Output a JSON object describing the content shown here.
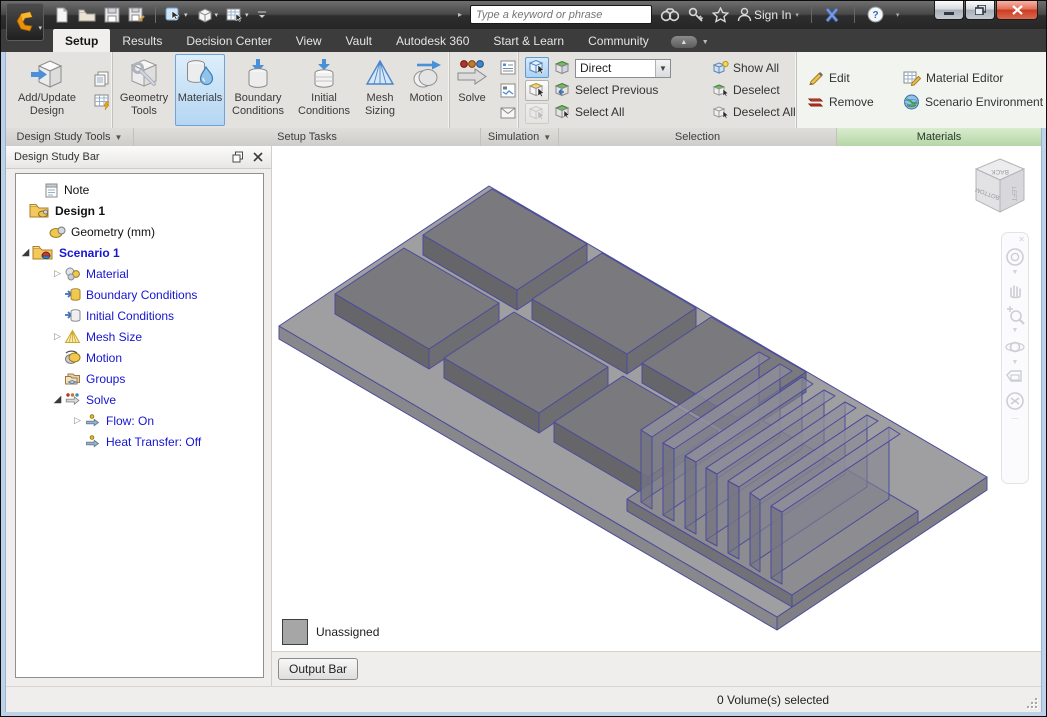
{
  "colors": {
    "selection_highlight": "#b5d6f2",
    "materials_panel_green": "#b5d6a6",
    "tree_item_blue": "#1515d2",
    "close_button_red": "#cc3b22",
    "model_fill_gray": "#8f8f93",
    "model_edge_purple": "#4b4b9b"
  },
  "titlebar": {
    "search_placeholder": "Type a keyword or phrase",
    "sign_in_label": "Sign In"
  },
  "tabs": {
    "items": [
      {
        "label": "Setup"
      },
      {
        "label": "Results"
      },
      {
        "label": "Decision Center"
      },
      {
        "label": "View"
      },
      {
        "label": "Vault"
      },
      {
        "label": "Autodesk 360"
      },
      {
        "label": "Start & Learn"
      },
      {
        "label": "Community"
      }
    ],
    "active_tab": "Setup"
  },
  "ribbon": {
    "design_study_tools": {
      "label": "Design Study Tools",
      "add_update_design": "Add/Update Design"
    },
    "setup_tasks": {
      "label": "Setup Tasks",
      "geometry_tools": "Geometry Tools",
      "materials": "Materials",
      "boundary_conditions": "Boundary Conditions",
      "initial_conditions": "Initial Conditions",
      "mesh_sizing": "Mesh Sizing",
      "motion": "Motion",
      "active_task": "Materials"
    },
    "simulation": {
      "label": "Simulation",
      "solve": "Solve"
    },
    "selection": {
      "label": "Selection",
      "mode_value": "Direct",
      "select_previous": "Select Previous",
      "select_all": "Select All",
      "show_all": "Show All",
      "deselect": "Deselect",
      "deselect_all": "Deselect All"
    },
    "materials_panel": {
      "label": "Materials",
      "edit": "Edit",
      "remove": "Remove",
      "material_editor": "Material Editor",
      "scenario_environment": "Scenario Environment"
    }
  },
  "design_study_bar": {
    "title": "Design Study Bar",
    "tree": [
      {
        "label": "Note"
      },
      {
        "label": "Design 1"
      },
      {
        "label": "Geometry (mm)"
      },
      {
        "label": "Scenario 1"
      },
      {
        "label": "Material"
      },
      {
        "label": "Boundary Conditions"
      },
      {
        "label": "Initial Conditions"
      },
      {
        "label": "Mesh Size"
      },
      {
        "label": "Motion"
      },
      {
        "label": "Groups"
      },
      {
        "label": "Solve"
      },
      {
        "label": "Flow: On"
      },
      {
        "label": "Heat Transfer: Off"
      }
    ]
  },
  "viewport": {
    "legend_label": "Unassigned",
    "viewcube": {
      "top": "BACK",
      "left": "BOTTOM",
      "right": "LEFT"
    }
  },
  "output_bar": {
    "button_label": "Output Bar"
  },
  "status_bar": {
    "message": "0 Volume(s) selected"
  }
}
